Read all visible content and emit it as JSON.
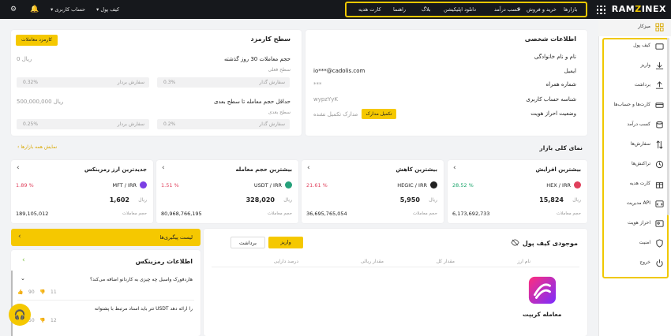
{
  "topbar": {
    "nav": [
      "بازارها",
      "خرید و فروش",
      "کسب درآمد",
      "دانلود اپلیکیشن",
      "بلاگ",
      "راهنما",
      "کارت هدیه"
    ],
    "wallet_label": "کیف پول",
    "account_label": "حساب کاربری",
    "logo_text_left": "RAM",
    "logo_text_z": "Z",
    "logo_text_right": "INEX",
    "highlight_color": "#f0c800"
  },
  "sidebar": {
    "dashboard": "میزکار",
    "items": [
      "کیف پول",
      "واریز",
      "برداشت",
      "کارت‌ها و حساب‌ها",
      "کسب درآمد",
      "سفارش‌ها",
      "تراکنش‌ها",
      "کارت هدیه",
      "مدیریت API",
      "احراز هویت",
      "امنیت",
      "خروج"
    ]
  },
  "personal": {
    "title": "اطلاعات شخصی",
    "rows": [
      "نام و نام خانوادگی",
      "ایمیل",
      "شماره همراه",
      "شناسه حساب کاربری",
      "وضعیت احراز هویت"
    ],
    "email": "io***@cadolis.com",
    "phone": "***",
    "user_id": "wypzYyK",
    "kyc_status": "مدارک تکمیل نشده",
    "kyc_button": "تکمیل مدارک"
  },
  "fee": {
    "title": "سطح کارمزد",
    "button": "کارمزد معاملات",
    "volume_label": "حجم معاملات 30 روز گذشته",
    "volume_value": "0 ریال",
    "current_level": "سطح فعلی",
    "maker": "سفارش گذار",
    "taker": "سفارش بردار",
    "cur_maker_fee": "0.3%",
    "cur_taker_fee": "0.32%",
    "min_label": "حداقل حجم معامله تا سطح بعدی",
    "min_value": "500,000,000 ریال",
    "next_level": "سطح بعدی",
    "next_maker_fee": "0.2%",
    "next_taker_fee": "0.25%"
  },
  "market": {
    "title": "نمای کلی بازار",
    "show_all": "نمایش همه بازارها",
    "volume_caption": "حجم معاملات",
    "rial": "ریال",
    "cards": [
      {
        "title": "بیشترین افزایش",
        "pair": "HEX / IRR",
        "pct": "28.52 %",
        "price": "15,824",
        "volume": "6,173,692,733",
        "color": "#e0405c"
      },
      {
        "title": "بیشترین کاهش",
        "pair": "HEGIC / IRR",
        "pct": "21.61 %",
        "price": "5,950",
        "volume": "36,695,765,054",
        "color": "#222222"
      },
      {
        "title": "بیشترین حجم معامله",
        "pair": "USDT / IRR",
        "pct": "1.51 %",
        "price": "328,020",
        "volume": "80,968,766,195",
        "color": "#26a17b"
      },
      {
        "title": "جدیدترین ارز رمزینکس",
        "pair": "MFT / IRR",
        "pct": "1.89 %",
        "price": "1,602",
        "volume": "189,105,012",
        "color": "#7b3fe4"
      }
    ]
  },
  "wallet": {
    "title": "موجودی کیف پول",
    "deposit": "واریز",
    "withdraw": "برداشت",
    "columns": [
      "نام ارز",
      "مقدار کل",
      "مقدار ریالی",
      "درصد دارایی"
    ],
    "empty_text": "معامله کریپت"
  },
  "watchlist": {
    "label": "لیست پیگیری‌ها"
  },
  "news": {
    "title": "اطلاعات رمزینکس",
    "items": [
      {
        "text": "هاردفورک واسیل چه چیزی به کاردانو اضافه می‌کند؟",
        "likes": "90",
        "dislikes": "11"
      },
      {
        "text": "تتر باید اسناد مرتبط با پشتوانه USDT را ارائه دهد",
        "likes": "50",
        "dislikes": "12"
      }
    ]
  }
}
